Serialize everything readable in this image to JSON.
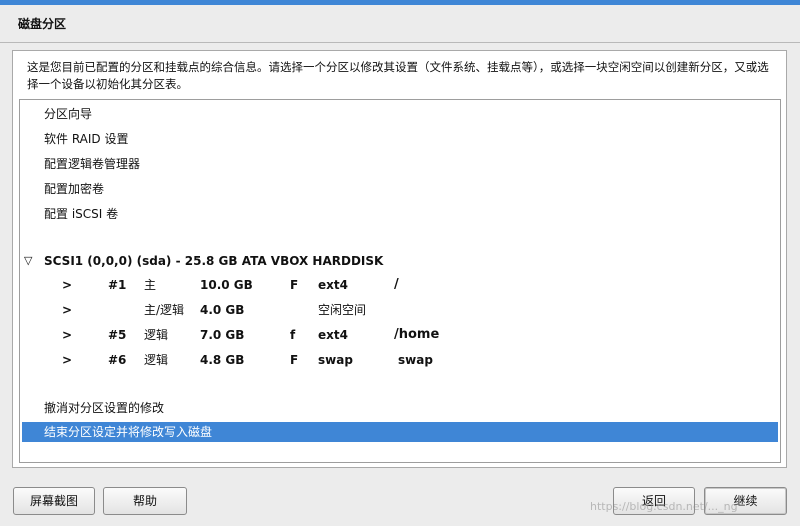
{
  "window": {
    "title": "磁盘分区"
  },
  "description": "这是您目前已配置的分区和挂载点的综合信息。请选择一个分区以修改其设置（文件系统、挂载点等），或选择一块空闲空间以创建新分区，又或选择一个设备以初始化其分区表。",
  "menu_items": [
    "分区向导",
    "软件 RAID 设置",
    "配置逻辑卷管理器",
    "配置加密卷",
    "配置 iSCSI 卷"
  ],
  "disk": {
    "expander": "▽",
    "label": "SCSI1 (0,0,0) (sda) - 25.8 GB ATA VBOX HARDDISK"
  },
  "partitions": [
    {
      "arrow": ">",
      "num": "#1",
      "type": "主",
      "size": "10.0 GB",
      "flag": "F",
      "fs": "ext4",
      "mount": "/"
    },
    {
      "arrow": ">",
      "num": "",
      "type": "主/逻辑",
      "size": "4.0 GB",
      "flag": "",
      "fs": "空闲空间",
      "mount": ""
    },
    {
      "arrow": ">",
      "num": "#5",
      "type": "逻辑",
      "size": "7.0 GB",
      "flag": "f",
      "fs": "ext4",
      "mount": "/home"
    },
    {
      "arrow": ">",
      "num": "#6",
      "type": "逻辑",
      "size": "4.8 GB",
      "flag": "F",
      "fs": "swap",
      "mount": "swap"
    }
  ],
  "actions": {
    "undo": "撤消对分区设置的修改",
    "finish": "结束分区设定并将修改写入磁盘"
  },
  "buttons": {
    "screenshot": "屏幕截图",
    "help": "帮助",
    "back": "返回",
    "continue": "继续"
  },
  "watermark": "https://blog.csdn.net/..._ng",
  "colors": {
    "accent": "#3f86d6",
    "background": "#ececec",
    "panel": "#ffffff"
  }
}
